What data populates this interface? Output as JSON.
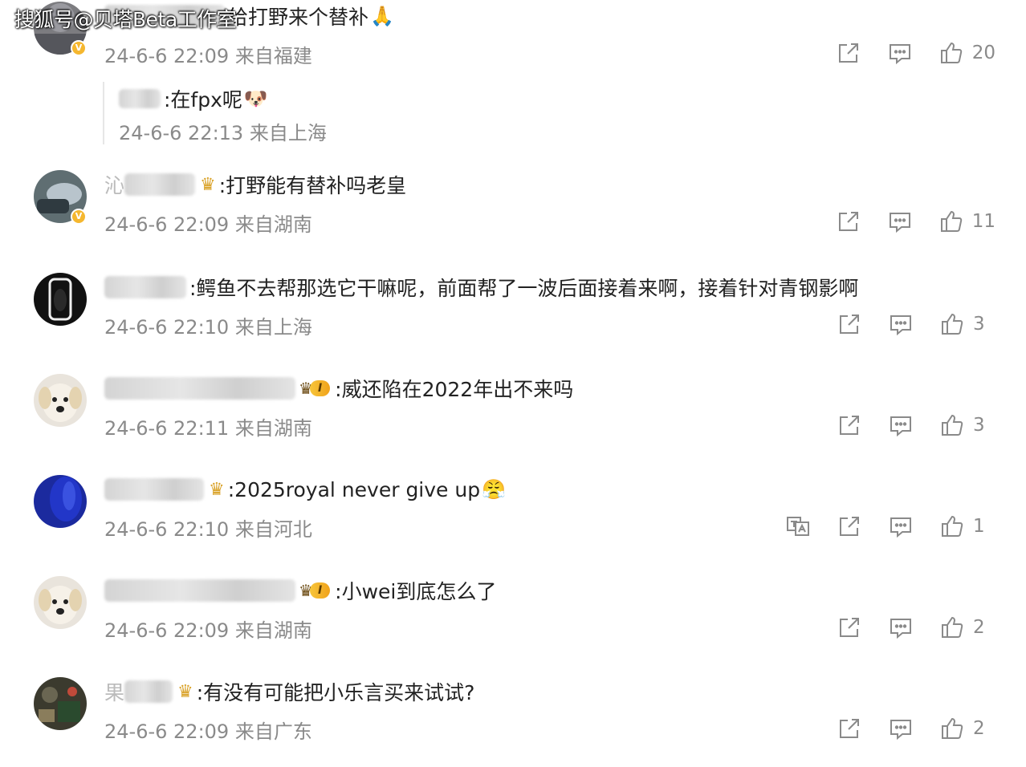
{
  "watermark": "搜狐号@贝塔Beta工作室",
  "colors": {
    "meta_text": "#8a8a8a",
    "comment_text": "#222222",
    "crown": "#d9a126",
    "vbadge": "#f5b72f"
  },
  "comments": [
    {
      "text": "给打野来个替补",
      "emoji": "🙏",
      "meta": "24-6-6 22:09 来自福建",
      "like_count": "20",
      "verified": true,
      "reply": {
        "text": ":在fpx呢",
        "emoji": "🐶",
        "meta": "24-6-6 22:13 来自上海"
      }
    },
    {
      "name_prefix": "沁",
      "text": ":打野能有替补吗老皇",
      "meta": "24-6-6 22:09 来自湖南",
      "like_count": "11",
      "verified": true
    },
    {
      "text": ":鳄鱼不去帮那选它干嘛呢，前面帮了一波后面接着来啊，接着针对青钢影啊",
      "meta": "24-6-6 22:10 来自上海",
      "like_count": "3"
    },
    {
      "text": ":威还陷在2022年出不来吗",
      "meta": "24-6-6 22:11 来自湖南",
      "like_count": "3",
      "vip_level": "I"
    },
    {
      "text": ":2025royal never give up",
      "emoji": "😤",
      "meta": "24-6-6 22:10 来自河北",
      "like_count": "1",
      "has_translate": true
    },
    {
      "text": ":小wei到底怎么了",
      "meta": "24-6-6 22:09 来自湖南",
      "like_count": "2",
      "vip_level": "I"
    },
    {
      "name_prefix": "果",
      "text": ":有没有可能把小乐言买来试试?",
      "meta": "24-6-6 22:09 来自广东",
      "like_count": "2"
    }
  ]
}
